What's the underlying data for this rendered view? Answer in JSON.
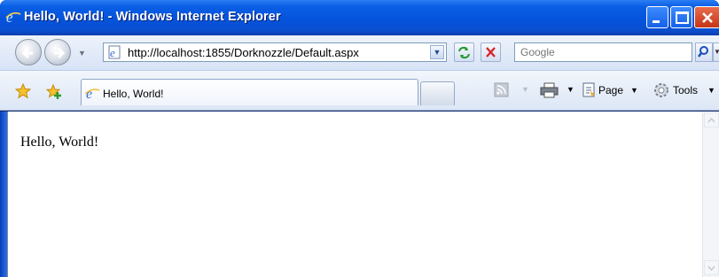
{
  "window": {
    "title": "Hello, World! - Windows Internet Explorer",
    "caption_buttons": [
      "minimize",
      "maximize",
      "close"
    ]
  },
  "navigation": {
    "back_icon": "back-arrow-icon",
    "forward_icon": "forward-arrow-icon",
    "address_url": "http://localhost:1855/Dorknozzle/Default.aspx",
    "search_placeholder": "Google"
  },
  "tabs": {
    "active_tab_label": "Hello, World!"
  },
  "commandbar": {
    "page_label": "Page",
    "tools_label": "Tools"
  },
  "content": {
    "body_text": "Hello, World!"
  },
  "colors": {
    "titlebar": "#0553dc",
    "close_button": "#c43516",
    "toolbar_bg": "#dce6f5"
  }
}
